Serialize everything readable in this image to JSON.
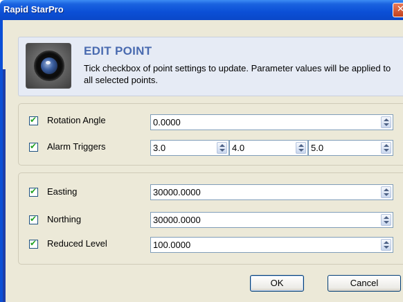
{
  "window": {
    "title": "Rapid StarPro",
    "close_glyph": "✕"
  },
  "header": {
    "icon": "camera-lens-icon",
    "title": "EDIT POINT",
    "description": "Tick checkbox of point settings to update. Parameter values will be applied to all selected points."
  },
  "group1": {
    "rotation": {
      "label": "Rotation Angle",
      "checked": true,
      "value": "0.0000"
    },
    "alarm": {
      "label": "Alarm Triggers",
      "checked": true,
      "values": [
        "3.0",
        "4.0",
        "5.0"
      ]
    }
  },
  "group2": {
    "easting": {
      "label": "Easting",
      "checked": true,
      "value": "30000.0000"
    },
    "northing": {
      "label": "Northing",
      "checked": true,
      "value": "30000.0000"
    },
    "reduced_level": {
      "label": "Reduced Level",
      "checked": true,
      "value": "100.0000"
    }
  },
  "buttons": {
    "ok": "OK",
    "cancel": "Cancel"
  },
  "check_glyph": "✔"
}
